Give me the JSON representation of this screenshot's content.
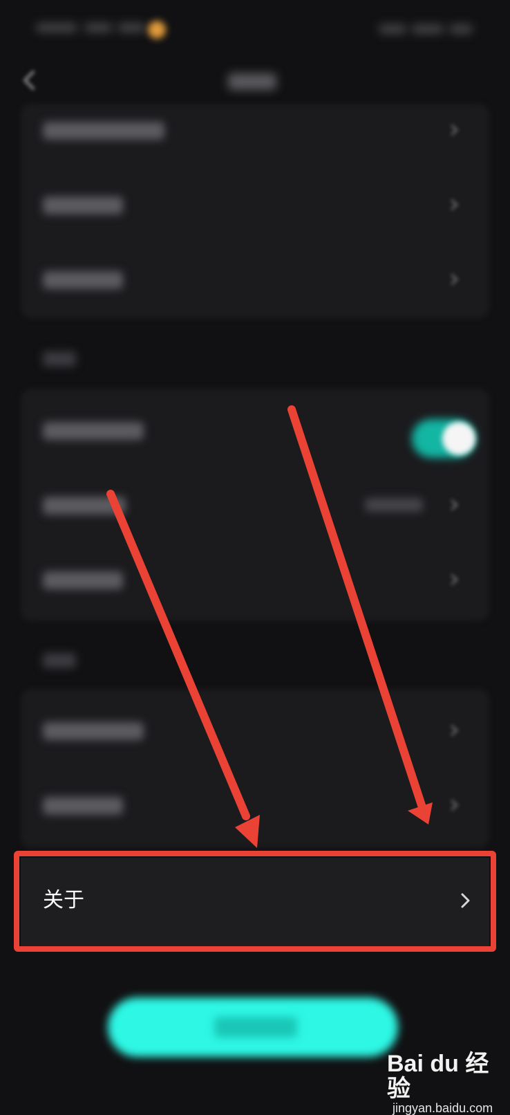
{
  "about_row": {
    "label": "关于",
    "chevron_icon": "chevron-right-icon"
  },
  "highlight": {
    "color": "#ea4335"
  },
  "watermark": {
    "brand": "Bai du 经验",
    "url": "jingyan.baidu.com"
  },
  "colors": {
    "background": "#111113",
    "card": "#1b1b1e",
    "toggle_on": "#13b5a3",
    "logout_button": "#2ef7e4"
  }
}
